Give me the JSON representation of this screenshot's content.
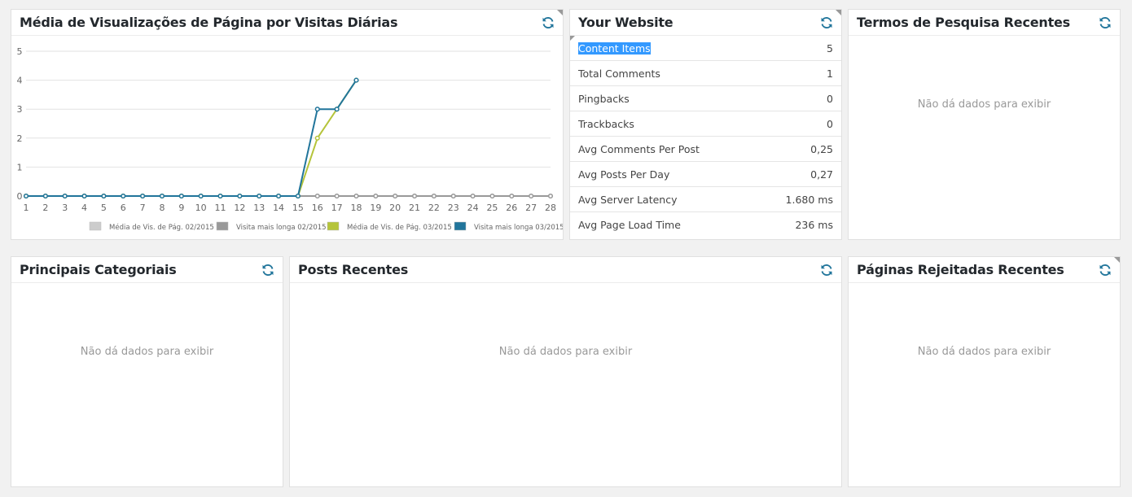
{
  "panels": {
    "pageviews": {
      "title": "Média de Visualizações de Página por Visitas Diárias"
    },
    "website": {
      "title": "Your Website",
      "rows": [
        {
          "label": "Content Items",
          "value": "5"
        },
        {
          "label": "Total Comments",
          "value": "1"
        },
        {
          "label": "Pingbacks",
          "value": "0"
        },
        {
          "label": "Trackbacks",
          "value": "0"
        },
        {
          "label": "Avg Comments Per Post",
          "value": "0,25"
        },
        {
          "label": "Avg Posts Per Day",
          "value": "0,27"
        },
        {
          "label": "Avg Server Latency",
          "value": "1.680 ms"
        },
        {
          "label": "Avg Page Load Time",
          "value": "236 ms"
        }
      ]
    },
    "search_terms": {
      "title": "Termos de Pesquisa Recentes",
      "empty_text": "Não dá dados para exibir"
    },
    "categories": {
      "title": "Principais Categoriais",
      "empty_text": "Não dá dados para exibir"
    },
    "recent_posts": {
      "title": "Posts Recentes",
      "empty_text": "Não dá dados para exibir"
    },
    "rejected_pages": {
      "title": "Páginas Rejeitadas Recentes",
      "empty_text": "Não dá dados para exibir"
    }
  },
  "colors": {
    "accent_blue": "#21759b",
    "series_grey_light": "#cccccc",
    "series_grey_dark": "#999999",
    "series_green": "#b5c43a",
    "series_blue": "#21759b",
    "selection": "#3399ff"
  },
  "icons": {
    "refresh": "refresh-icon"
  },
  "chart_data": {
    "type": "line",
    "x": [
      1,
      2,
      3,
      4,
      5,
      6,
      7,
      8,
      9,
      10,
      11,
      12,
      13,
      14,
      15,
      16,
      17,
      18,
      19,
      20,
      21,
      22,
      23,
      24,
      25,
      26,
      27,
      28
    ],
    "yticks": [
      0,
      1,
      2,
      3,
      4,
      5
    ],
    "ylim": [
      0,
      5
    ],
    "xlim": [
      1,
      28
    ],
    "grid": true,
    "legend_position": "bottom-right",
    "series": [
      {
        "name": "Média de Vis. de Pág. 02/2015",
        "color": "#cccccc",
        "values": [
          0,
          0,
          0,
          0,
          0,
          0,
          0,
          0,
          0,
          0,
          0,
          0,
          0,
          0,
          0,
          0,
          0,
          0,
          0,
          0,
          0,
          0,
          0,
          0,
          0,
          0,
          0,
          0
        ]
      },
      {
        "name": "Visita mais longa 02/2015",
        "color": "#999999",
        "values": [
          0,
          0,
          0,
          0,
          0,
          0,
          0,
          0,
          0,
          0,
          0,
          0,
          0,
          0,
          0,
          0,
          0,
          0,
          0,
          0,
          0,
          0,
          0,
          0,
          0,
          0,
          0,
          0
        ]
      },
      {
        "name": "Média de Vis. de Pág. 03/2015",
        "color": "#b5c43a",
        "values": [
          0,
          0,
          0,
          0,
          0,
          0,
          0,
          0,
          0,
          0,
          0,
          0,
          0,
          0,
          0,
          2,
          3,
          4
        ]
      },
      {
        "name": "Visita mais longa 03/2015",
        "color": "#21759b",
        "values": [
          0,
          0,
          0,
          0,
          0,
          0,
          0,
          0,
          0,
          0,
          0,
          0,
          0,
          0,
          0,
          3,
          3,
          4
        ]
      }
    ]
  }
}
